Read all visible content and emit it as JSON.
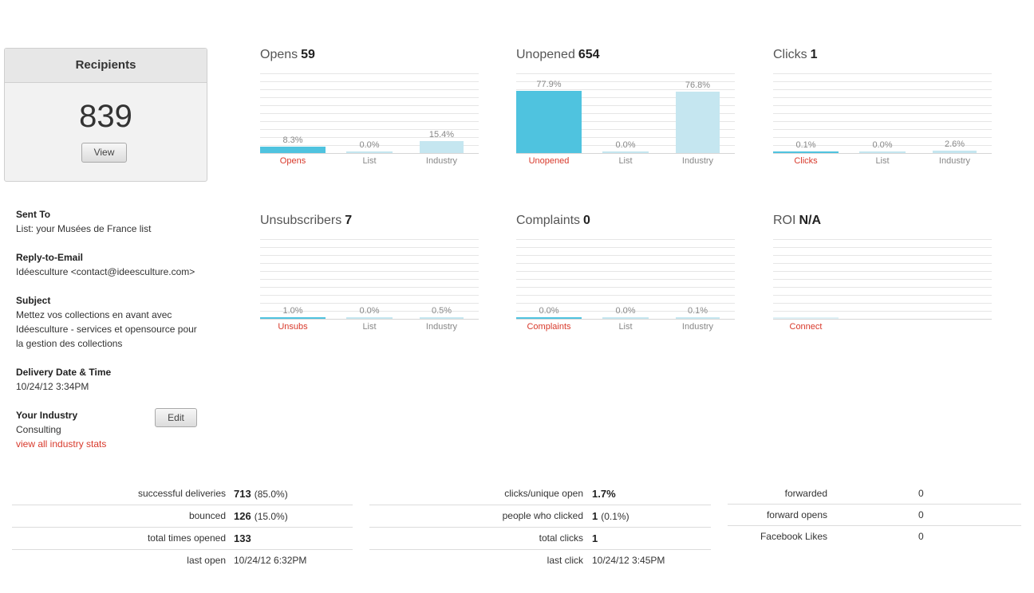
{
  "recipients": {
    "label": "Recipients",
    "count": "839",
    "view_label": "View"
  },
  "details": {
    "sent_to_label": "Sent To",
    "sent_to_value": "List: your Musées de France list",
    "reply_label": "Reply-to-Email",
    "reply_value": "Idéesculture <contact@ideesculture.com>",
    "subject_label": "Subject",
    "subject_line1": "Mettez vos collections en avant avec",
    "subject_line2": "Idéesculture - services et opensource pour",
    "subject_line3": "la gestion des collections",
    "delivery_label": "Delivery Date & Time",
    "delivery_value": "10/24/12 3:34PM",
    "industry_label": "Your Industry",
    "industry_value": "Consulting",
    "industry_link": "view all industry stats",
    "edit_label": "Edit"
  },
  "colors": {
    "accent": "#d8392b",
    "bar_primary": "#4fc3df",
    "bar_secondary": "#c5e6f0"
  },
  "charts": [
    {
      "title": "Opens",
      "value": "59",
      "bars": [
        {
          "label": "Opens",
          "pct": "8.3%",
          "v": 8.3,
          "primary": true
        },
        {
          "label": "List",
          "pct": "0.0%",
          "v": 0.0,
          "primary": false
        },
        {
          "label": "Industry",
          "pct": "15.4%",
          "v": 15.4,
          "primary": false
        }
      ]
    },
    {
      "title": "Unopened",
      "value": "654",
      "bars": [
        {
          "label": "Unopened",
          "pct": "77.9%",
          "v": 77.9,
          "primary": true
        },
        {
          "label": "List",
          "pct": "0.0%",
          "v": 0.0,
          "primary": false
        },
        {
          "label": "Industry",
          "pct": "76.8%",
          "v": 76.8,
          "primary": false
        }
      ]
    },
    {
      "title": "Clicks",
      "value": "1",
      "bars": [
        {
          "label": "Clicks",
          "pct": "0.1%",
          "v": 0.1,
          "primary": true
        },
        {
          "label": "List",
          "pct": "0.0%",
          "v": 0.0,
          "primary": false
        },
        {
          "label": "Industry",
          "pct": "2.6%",
          "v": 2.6,
          "primary": false
        }
      ]
    },
    {
      "title": "Unsubscribers",
      "value": "7",
      "bars": [
        {
          "label": "Unsubs",
          "pct": "1.0%",
          "v": 1.0,
          "primary": true
        },
        {
          "label": "List",
          "pct": "0.0%",
          "v": 0.0,
          "primary": false
        },
        {
          "label": "Industry",
          "pct": "0.5%",
          "v": 0.5,
          "primary": false
        }
      ]
    },
    {
      "title": "Complaints",
      "value": "0",
      "bars": [
        {
          "label": "Complaints",
          "pct": "0.0%",
          "v": 0.0,
          "primary": true
        },
        {
          "label": "List",
          "pct": "0.0%",
          "v": 0.0,
          "primary": false
        },
        {
          "label": "Industry",
          "pct": "0.1%",
          "v": 0.1,
          "primary": false
        }
      ]
    },
    {
      "title": "ROI",
      "value": "N/A",
      "bars": [
        {
          "label": "Connect",
          "pct": "",
          "v": 0,
          "primary": true
        }
      ]
    }
  ],
  "stats": {
    "col1": [
      {
        "k": "successful deliveries",
        "v": "713",
        "sub": "(85.0%)"
      },
      {
        "k": "bounced",
        "v": "126",
        "sub": "(15.0%)"
      },
      {
        "k": "total times opened",
        "v": "133",
        "sub": ""
      },
      {
        "k": "last open",
        "v": "",
        "sub": "10/24/12 6:32PM"
      }
    ],
    "col2": [
      {
        "k": "clicks/unique open",
        "v": "1.7%",
        "sub": ""
      },
      {
        "k": "people who clicked",
        "v": "1",
        "sub": "(0.1%)"
      },
      {
        "k": "total clicks",
        "v": "1",
        "sub": ""
      },
      {
        "k": "last click",
        "v": "",
        "sub": "10/24/12 3:45PM"
      }
    ],
    "col3": [
      {
        "k": "forwarded",
        "v": "",
        "sub": "0"
      },
      {
        "k": "forward opens",
        "v": "",
        "sub": "0"
      },
      {
        "k": "Facebook Likes",
        "v": "",
        "sub": "0"
      }
    ]
  }
}
